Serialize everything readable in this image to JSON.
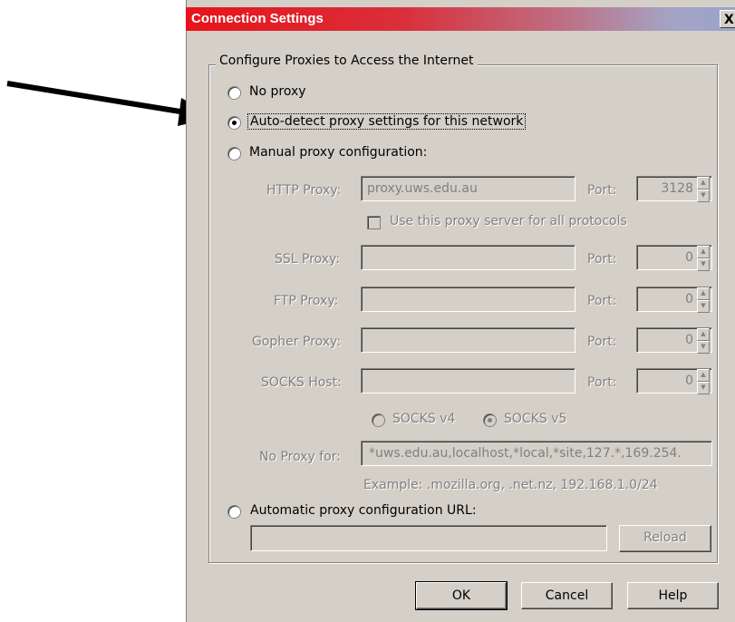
{
  "window": {
    "title": "Connection Settings",
    "close_label": "X"
  },
  "group": {
    "legend": "Configure Proxies to Access the Internet"
  },
  "options": {
    "no_proxy": "No proxy",
    "auto_detect": "Auto-detect proxy settings for this network",
    "manual": "Manual proxy configuration:",
    "auto_url": "Automatic proxy configuration URL:"
  },
  "manual": {
    "http_label": "HTTP Proxy:",
    "http_value": "proxy.uws.edu.au",
    "http_port_label": "Port:",
    "http_port": "3128",
    "use_all_label": "Use this proxy server for all protocols",
    "ssl_label": "SSL Proxy:",
    "ssl_value": "",
    "ssl_port_label": "Port:",
    "ssl_port": "0",
    "ftp_label": "FTP Proxy:",
    "ftp_value": "",
    "ftp_port_label": "Port:",
    "ftp_port": "0",
    "gopher_label": "Gopher Proxy:",
    "gopher_value": "",
    "gopher_port_label": "Port:",
    "gopher_port": "0",
    "socks_label": "SOCKS Host:",
    "socks_value": "",
    "socks_port_label": "Port:",
    "socks_port": "0",
    "socks_v4": "SOCKS v4",
    "socks_v5": "SOCKS v5",
    "no_proxy_label": "No Proxy for:",
    "no_proxy_value": "*uws.edu.au,localhost,*local,*site,127.*,169.254.",
    "example": "Example: .mozilla.org, .net.nz, 192.168.1.0/24"
  },
  "auto_url": {
    "value": "",
    "reload": "Reload"
  },
  "buttons": {
    "ok": "OK",
    "cancel": "Cancel",
    "help": "Help"
  },
  "selected_option": "auto_detect",
  "colors": {
    "title_gradient_start": "#e8131a",
    "title_gradient_end": "#9aa5cc",
    "dialog_bg": "#d4d0c8"
  },
  "icons": {
    "pointer": "arrow-pointer-icon"
  }
}
